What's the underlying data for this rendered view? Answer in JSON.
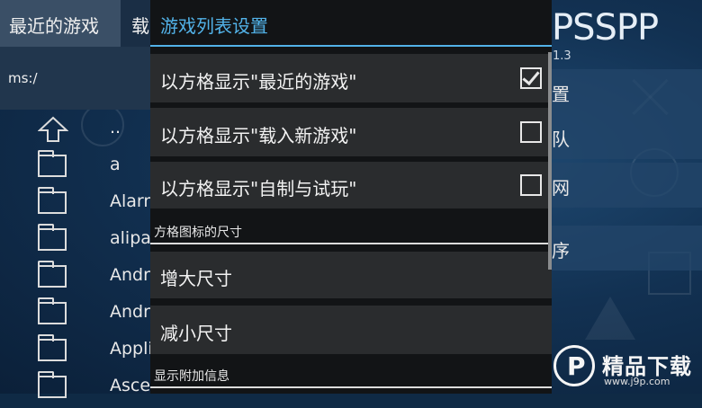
{
  "tabs": {
    "recent": "最近的游戏",
    "load_partial": "载"
  },
  "path": "ms:/",
  "files": [
    {
      "name": "..",
      "kind": "up"
    },
    {
      "name": "a",
      "kind": "folder"
    },
    {
      "name": "Alarn",
      "kind": "folder"
    },
    {
      "name": "alipa",
      "kind": "folder"
    },
    {
      "name": "Andro",
      "kind": "folder"
    },
    {
      "name": "Andro",
      "kind": "folder"
    },
    {
      "name": "Appli",
      "kind": "folder"
    },
    {
      "name": "Asce",
      "kind": "folder"
    }
  ],
  "right": {
    "logo": "PSSPP",
    "version": "1.3",
    "menu_fragments": [
      "置",
      "队",
      "网",
      "序"
    ]
  },
  "dialog": {
    "title": "游戏列表设置",
    "items": [
      {
        "label": "以方格显示\"最近的游戏\"",
        "checked": true
      },
      {
        "label": "以方格显示\"载入新游戏\"",
        "checked": false
      },
      {
        "label": "以方格显示\"自制与试玩\"",
        "checked": false
      }
    ],
    "section_icon_size": "方格图标的尺寸",
    "increase_size": "增大尺寸",
    "decrease_size": "减小尺寸",
    "section_extra_info": "显示附加信息"
  },
  "watermark": {
    "name": "精品下载",
    "url": "www.j9p.com"
  },
  "colors": {
    "accent": "#52b2e8",
    "dialog_bg": "#121416",
    "item_bg": "#2a2c2e"
  }
}
